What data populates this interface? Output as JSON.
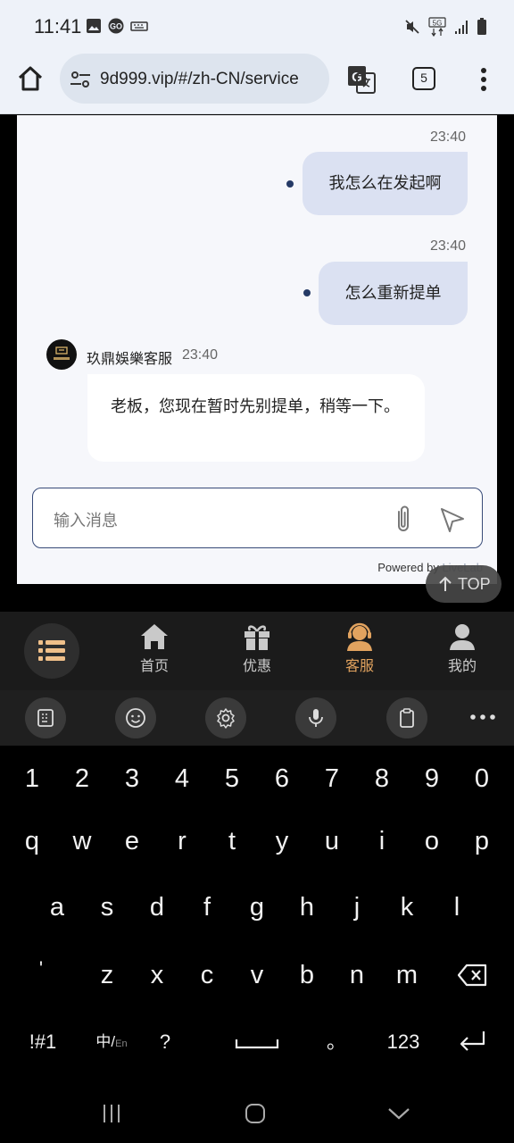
{
  "status_bar": {
    "time": "11:41",
    "left_icons": [
      "image-icon",
      "go-icon",
      "keyboard-icon"
    ],
    "right_icons": [
      "mute-icon",
      "5g-icon",
      "signal-icon",
      "battery-icon"
    ]
  },
  "browser": {
    "url": "9d999.vip/#/zh-CN/service",
    "tab_count": "5"
  },
  "chat": {
    "messages": [
      {
        "from": "user",
        "time": "23:40",
        "text": "我怎么在发起啊"
      },
      {
        "from": "user",
        "time": "23:40",
        "text": "怎么重新提单"
      },
      {
        "from": "agent",
        "name": "玖鼎娛樂客服",
        "time": "23:40",
        "text": "老板，您现在暂时先别提单，稍等一下。"
      }
    ],
    "input_placeholder": "输入消息",
    "powered_prefix": "Powered by ",
    "powered_brand": "LiveLab"
  },
  "top_button": "TOP",
  "bottom_nav": {
    "items": [
      {
        "label": "首页",
        "icon": "home-icon"
      },
      {
        "label": "优惠",
        "icon": "gift-icon"
      },
      {
        "label": "客服",
        "icon": "support-agent-icon",
        "active": true
      },
      {
        "label": "我的",
        "icon": "user-icon"
      }
    ],
    "active_color": "#e2a35f"
  },
  "keyboard": {
    "toolbar_icons": [
      "sticker-icon",
      "emoji-icon",
      "settings-icon",
      "mic-icon",
      "clipboard-icon",
      "more-icon"
    ],
    "row_numbers": [
      "1",
      "2",
      "3",
      "4",
      "5",
      "6",
      "7",
      "8",
      "9",
      "0"
    ],
    "row1": [
      "q",
      "w",
      "e",
      "r",
      "t",
      "y",
      "u",
      "i",
      "o",
      "p"
    ],
    "row2": [
      "a",
      "s",
      "d",
      "f",
      "g",
      "h",
      "j",
      "k",
      "l"
    ],
    "row3": [
      "'",
      "z",
      "x",
      "c",
      "v",
      "b",
      "n",
      "m"
    ],
    "symbols_key": "!#1",
    "lang_key": "中/",
    "lang_key_sub": "En",
    "question_key": "?",
    "period_key": "。",
    "numbers_key": "123"
  }
}
